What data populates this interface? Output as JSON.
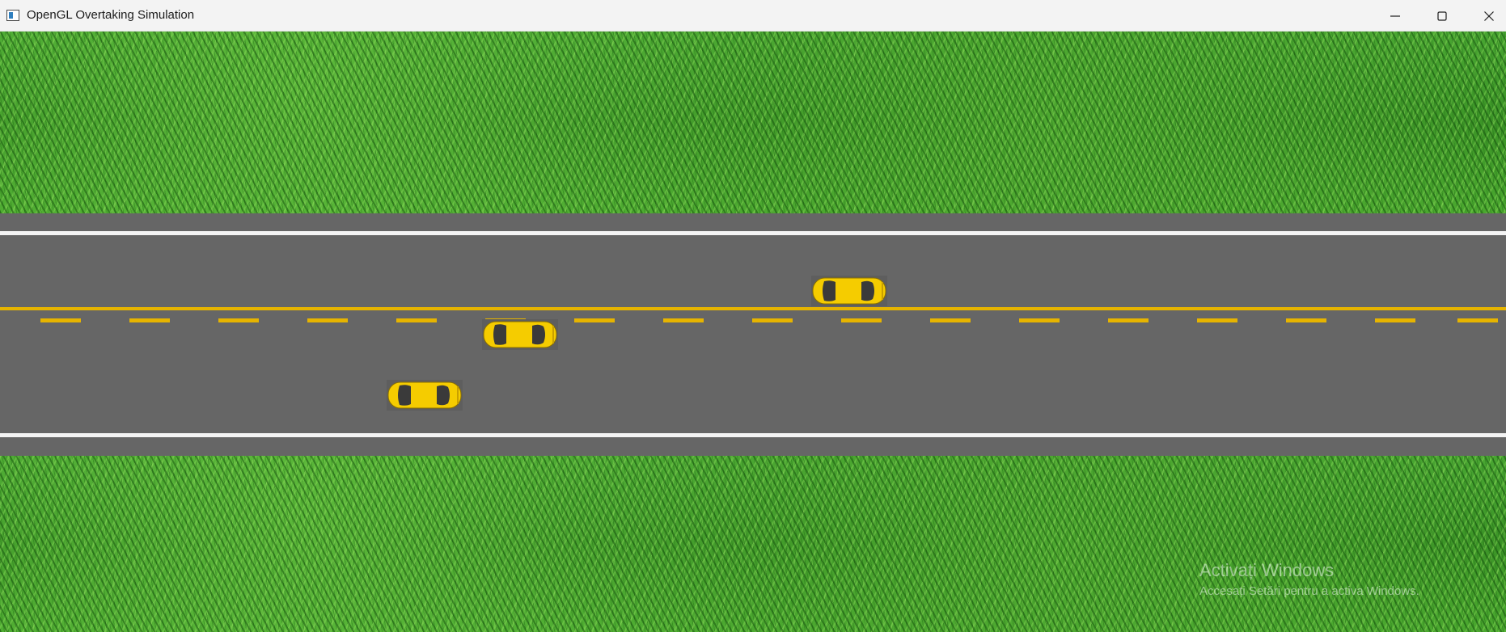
{
  "window": {
    "title": "OpenGL Overtaking Simulation",
    "icon": "app-window-icon",
    "controls": [
      "minimize-icon",
      "maximize-icon",
      "close-icon"
    ]
  },
  "scene": {
    "background": "grass",
    "road": {
      "color": "#666666",
      "edge_line_color": "#f4f4f4",
      "center_line_color": "#e6b400"
    },
    "cars": [
      {
        "name": "car-upper-lane",
        "color": "#f5cc00",
        "direction": "right"
      },
      {
        "name": "car-center-overtaking",
        "color": "#f5cc00",
        "direction": "right"
      },
      {
        "name": "car-lower-lane",
        "color": "#f5cc00",
        "direction": "right"
      }
    ]
  },
  "watermark": {
    "title": "Activați Windows",
    "subtitle": "Accesați Setări pentru a activa Windows."
  }
}
